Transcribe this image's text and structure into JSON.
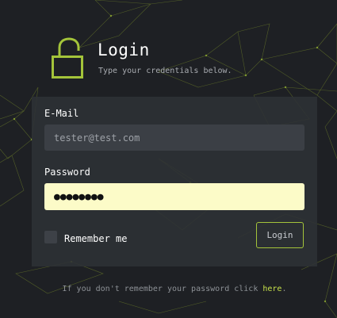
{
  "header": {
    "title": "Login",
    "subtitle": "Type your credentials below.",
    "icon": "lock-open-icon",
    "accent_color": "#a4c43a"
  },
  "form": {
    "email_label": "E-Mail",
    "email_placeholder": "tester@test.com",
    "password_label": "Password",
    "password_mask": "●●●●●●●●",
    "remember_label": "Remember me",
    "remember_checked": false,
    "login_label": "Login"
  },
  "footer": {
    "text_before": "If you don't remember your password click ",
    "link_label": "here",
    "text_after": "."
  }
}
